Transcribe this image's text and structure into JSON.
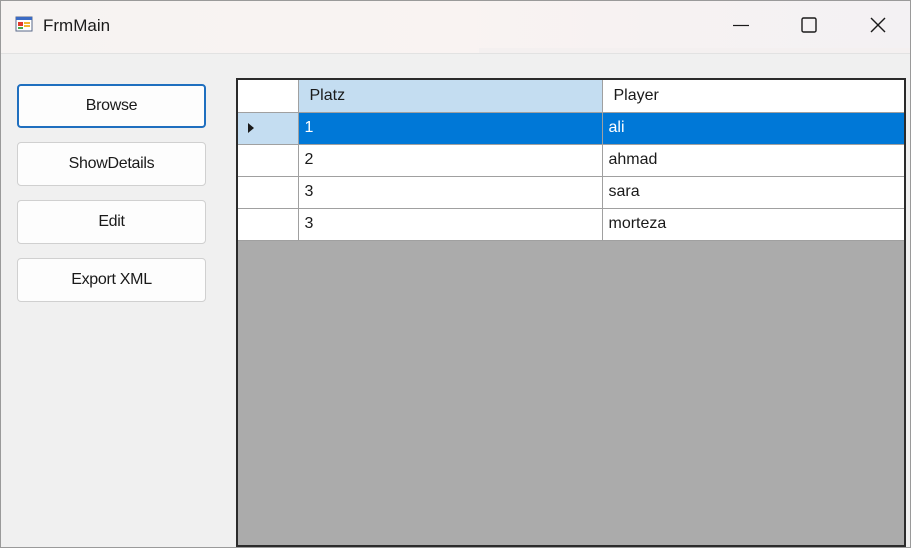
{
  "window": {
    "title": "FrmMain"
  },
  "sidebar": {
    "buttons": [
      {
        "label": "Browse"
      },
      {
        "label": "ShowDetails"
      },
      {
        "label": "Edit"
      },
      {
        "label": "Export XML"
      }
    ]
  },
  "grid": {
    "columns": [
      "Platz",
      "Player"
    ],
    "selected_row": 0,
    "rows": [
      {
        "platz": "1",
        "player": "ali"
      },
      {
        "platz": "2",
        "player": "ahmad"
      },
      {
        "platz": "3",
        "player": "sara"
      },
      {
        "platz": "3",
        "player": "morteza"
      }
    ]
  },
  "icons": {
    "app": "form-app-icon",
    "minimize": "minimize-icon",
    "maximize": "maximize-icon",
    "close": "close-icon",
    "row_indicator": "row-indicator-arrow-icon"
  },
  "colors": {
    "selection": "#0078d7",
    "header_highlight": "#c4ddf1",
    "grid_background": "#ababab",
    "focus_border": "#1f6fbf"
  }
}
